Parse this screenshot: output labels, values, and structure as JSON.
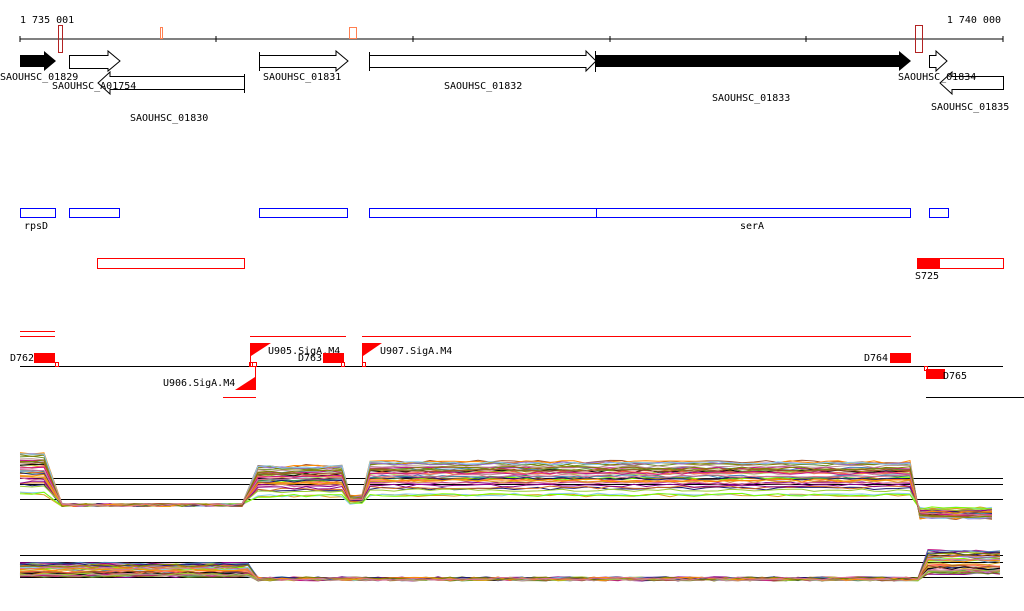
{
  "ruler": {
    "start_label": "1 735 001",
    "end_label": "1 740 000"
  },
  "genes": [
    {
      "id": "SAOUHSC_01829",
      "strand": "+",
      "filled": true
    },
    {
      "id": "SAOUHSC_A01754",
      "strand": "+",
      "filled": false
    },
    {
      "id": "SAOUHSC_01830",
      "strand": "-",
      "filled": false
    },
    {
      "id": "SAOUHSC_01831",
      "strand": "+",
      "filled": false
    },
    {
      "id": "SAOUHSC_01832",
      "strand": "+",
      "filled": false
    },
    {
      "id": "SAOUHSC_01833",
      "strand": "+",
      "filled": true
    },
    {
      "id": "SAOUHSC_01834",
      "strand": "+",
      "filled": false
    },
    {
      "id": "SAOUHSC_01835",
      "strand": "-",
      "filled": false
    }
  ],
  "gene_names": {
    "rpsD": "rpsD",
    "serA": "serA"
  },
  "srna": {
    "s725": "S725"
  },
  "features": {
    "d762": "D762",
    "d763": "D763",
    "d764": "D764",
    "d765": "D765",
    "u905": "U905.SigA.M4",
    "u906": "U906.SigA.M4",
    "u907": "U907.SigA.M4"
  },
  "colors": {
    "gene_track": "#0000ff",
    "feature": "#ff0000",
    "marker_dark": "#b22222",
    "marker_light": "#ff7f50"
  }
}
